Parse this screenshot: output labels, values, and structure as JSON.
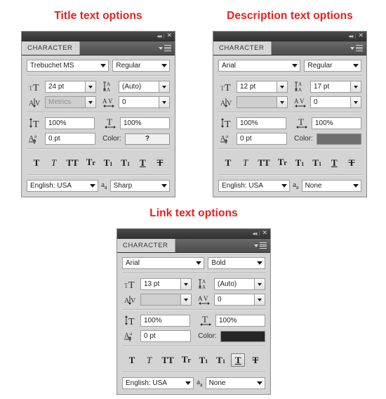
{
  "page": {
    "background": "#ffffff",
    "title_color": "#e32121"
  },
  "panels": [
    {
      "id": "title",
      "group_title": "Title text options",
      "titlebar": {
        "collapse_icon": "collapse-double-left-icon",
        "close_icon": "close-icon",
        "collapse_glyph": "◂◂",
        "close_glyph": "✕"
      },
      "tab_label": "CHARACTER",
      "menu_icon": "panel-menu-icon",
      "font_family": "Trebuchet MS",
      "font_style": "Regular",
      "size_icon": "font-size-icon",
      "font_size": "24 pt",
      "leading_icon": "leading-icon",
      "leading": "(Auto)",
      "kerning_icon": "kerning-icon",
      "kerning": "Metrics",
      "kerning_disabled": true,
      "tracking_icon": "tracking-icon",
      "tracking": "0",
      "vscale_icon": "vertical-scale-icon",
      "vertical_scale": "100%",
      "hscale_icon": "horizontal-scale-icon",
      "horizontal_scale": "100%",
      "baseline_icon": "baseline-shift-icon",
      "baseline_shift": "0 pt",
      "color_label": "Color:",
      "color_value": "?",
      "color_swatch": "#f0f0f0",
      "color_is_unknown": true,
      "language": "English: USA",
      "aa_icon": "anti-alias-icon",
      "anti_alias": "Sharp",
      "style_buttons": [
        {
          "name": "faux-bold-button",
          "glyph": "T",
          "kind": "bold",
          "active": false
        },
        {
          "name": "faux-italic-button",
          "glyph": "T",
          "kind": "italic",
          "active": false
        },
        {
          "name": "all-caps-button",
          "glyph": "TT",
          "kind": "caps",
          "active": false
        },
        {
          "name": "small-caps-button",
          "glyph": "Tr",
          "kind": "smallcaps",
          "active": false
        },
        {
          "name": "superscript-button",
          "glyph": "T",
          "kind": "superscript",
          "active": false
        },
        {
          "name": "subscript-button",
          "glyph": "T",
          "kind": "subscript",
          "active": false
        },
        {
          "name": "underline-button",
          "glyph": "T",
          "kind": "underline",
          "active": false
        },
        {
          "name": "strikethrough-button",
          "glyph": "T",
          "kind": "strikethrough",
          "active": false
        }
      ]
    },
    {
      "id": "description",
      "group_title": "Description text options",
      "titlebar": {
        "collapse_icon": "collapse-double-left-icon",
        "close_icon": "close-icon",
        "collapse_glyph": "◂◂",
        "close_glyph": "✕"
      },
      "tab_label": "CHARACTER",
      "menu_icon": "panel-menu-icon",
      "font_family": "Arial",
      "font_style": "Regular",
      "size_icon": "font-size-icon",
      "font_size": "12 pt",
      "leading_icon": "leading-icon",
      "leading": "17 pt",
      "kerning_icon": "kerning-icon",
      "kerning": "",
      "kerning_disabled": true,
      "tracking_icon": "tracking-icon",
      "tracking": "0",
      "vscale_icon": "vertical-scale-icon",
      "vertical_scale": "100%",
      "hscale_icon": "horizontal-scale-icon",
      "horizontal_scale": "100%",
      "baseline_icon": "baseline-shift-icon",
      "baseline_shift": "0 pt",
      "color_label": "Color:",
      "color_value": "",
      "color_swatch": "#6f6f6f",
      "color_is_unknown": false,
      "language": "English: USA",
      "aa_icon": "anti-alias-icon",
      "anti_alias": "None",
      "style_buttons": [
        {
          "name": "faux-bold-button",
          "glyph": "T",
          "kind": "bold",
          "active": false
        },
        {
          "name": "faux-italic-button",
          "glyph": "T",
          "kind": "italic",
          "active": false
        },
        {
          "name": "all-caps-button",
          "glyph": "TT",
          "kind": "caps",
          "active": false
        },
        {
          "name": "small-caps-button",
          "glyph": "Tr",
          "kind": "smallcaps",
          "active": false
        },
        {
          "name": "superscript-button",
          "glyph": "T",
          "kind": "superscript",
          "active": false
        },
        {
          "name": "subscript-button",
          "glyph": "T",
          "kind": "subscript",
          "active": false
        },
        {
          "name": "underline-button",
          "glyph": "T",
          "kind": "underline",
          "active": false
        },
        {
          "name": "strikethrough-button",
          "glyph": "T",
          "kind": "strikethrough",
          "active": false
        }
      ]
    },
    {
      "id": "link",
      "group_title": "Link text options",
      "titlebar": {
        "collapse_icon": "collapse-double-left-icon",
        "close_icon": "close-icon",
        "collapse_glyph": "◂◂",
        "close_glyph": "✕"
      },
      "tab_label": "CHARACTER",
      "menu_icon": "panel-menu-icon",
      "font_family": "Arial",
      "font_style": "Bold",
      "size_icon": "font-size-icon",
      "font_size": "13 pt",
      "leading_icon": "leading-icon",
      "leading": "(Auto)",
      "kerning_icon": "kerning-icon",
      "kerning": "",
      "kerning_disabled": true,
      "tracking_icon": "tracking-icon",
      "tracking": "0",
      "vscale_icon": "vertical-scale-icon",
      "vertical_scale": "100%",
      "hscale_icon": "horizontal-scale-icon",
      "horizontal_scale": "100%",
      "baseline_icon": "baseline-shift-icon",
      "baseline_shift": "0 pt",
      "color_label": "Color:",
      "color_value": "",
      "color_swatch": "#262626",
      "color_is_unknown": false,
      "language": "English: USA",
      "aa_icon": "anti-alias-icon",
      "anti_alias": "None",
      "style_buttons": [
        {
          "name": "faux-bold-button",
          "glyph": "T",
          "kind": "bold",
          "active": false
        },
        {
          "name": "faux-italic-button",
          "glyph": "T",
          "kind": "italic",
          "active": false
        },
        {
          "name": "all-caps-button",
          "glyph": "TT",
          "kind": "caps",
          "active": false
        },
        {
          "name": "small-caps-button",
          "glyph": "Tr",
          "kind": "smallcaps",
          "active": false
        },
        {
          "name": "superscript-button",
          "glyph": "T",
          "kind": "superscript",
          "active": false
        },
        {
          "name": "subscript-button",
          "glyph": "T",
          "kind": "subscript",
          "active": false
        },
        {
          "name": "underline-button",
          "glyph": "T",
          "kind": "underline",
          "active": true
        },
        {
          "name": "strikethrough-button",
          "glyph": "T",
          "kind": "strikethrough",
          "active": false
        }
      ]
    }
  ]
}
